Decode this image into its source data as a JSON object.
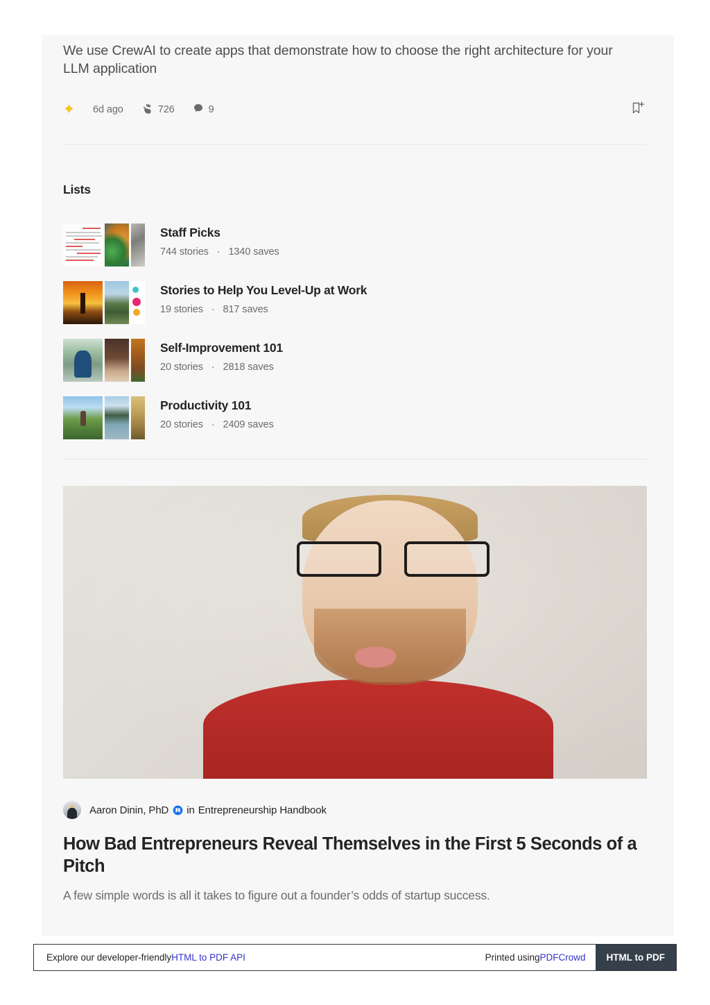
{
  "top_article": {
    "title": "We use CrewAI to create apps that demonstrate how to choose the right architecture for your LLM application",
    "star_icon": "sparkle-star-icon",
    "date": "6d ago",
    "clap_icon": "clap-hand-icon",
    "claps": "726",
    "comment_icon": "comment-bubble-icon",
    "comments": "9",
    "bookmark_icon": "bookmark-add-icon"
  },
  "lists": {
    "heading": "Lists",
    "items": [
      {
        "name": "Staff Picks",
        "stories": "744 stories",
        "separator": "·",
        "saves": "1340 saves",
        "thumbs": [
          "art-doc",
          "art-market",
          "art-gray"
        ]
      },
      {
        "name": "Stories to Help You Level-Up at Work",
        "stories": "19 stories",
        "separator": "·",
        "saves": "817 saves",
        "thumbs": [
          "art-sunset",
          "art-building",
          "art-shapes"
        ]
      },
      {
        "name": "Self-Improvement 101",
        "stories": "20 stories",
        "separator": "·",
        "saves": "2818 saves",
        "thumbs": [
          "art-person-blue",
          "art-darkbrown",
          "art-orange"
        ]
      },
      {
        "name": "Productivity 101",
        "stories": "20 stories",
        "separator": "·",
        "saves": "2409 saves",
        "thumbs": [
          "art-mountain",
          "art-lake",
          "art-field"
        ]
      }
    ]
  },
  "hero_article": {
    "image_alt": "man-with-glasses-making-silly-face-photo",
    "avatar_alt": "author-avatar",
    "author": "Aaron Dinin, PhD",
    "verified_icon": "medium-member-badge-icon",
    "in_label": "in",
    "publication": "Entrepreneurship Handbook",
    "title": "How Bad Entrepreneurs Reveal Themselves in the First 5 Seconds of a Pitch",
    "subtitle": "A few simple words is all it takes to figure out a founder’s odds of startup success."
  },
  "footer": {
    "left_prefix": "Explore our developer-friendly ",
    "left_link": "HTML to PDF API",
    "right_prefix": "Printed using ",
    "right_link": "PDFCrowd",
    "button": "HTML to PDF"
  },
  "colors": {
    "card_bg": "#f7f7f7",
    "page_bg": "#ffffff",
    "text_primary": "#242424",
    "text_secondary": "#6b6b6b",
    "star": "#f5c518",
    "link": "#3333cc",
    "footer_button_bg": "#36404a",
    "verified_badge": "#1a73e8",
    "divider": "#e8e8e8"
  }
}
